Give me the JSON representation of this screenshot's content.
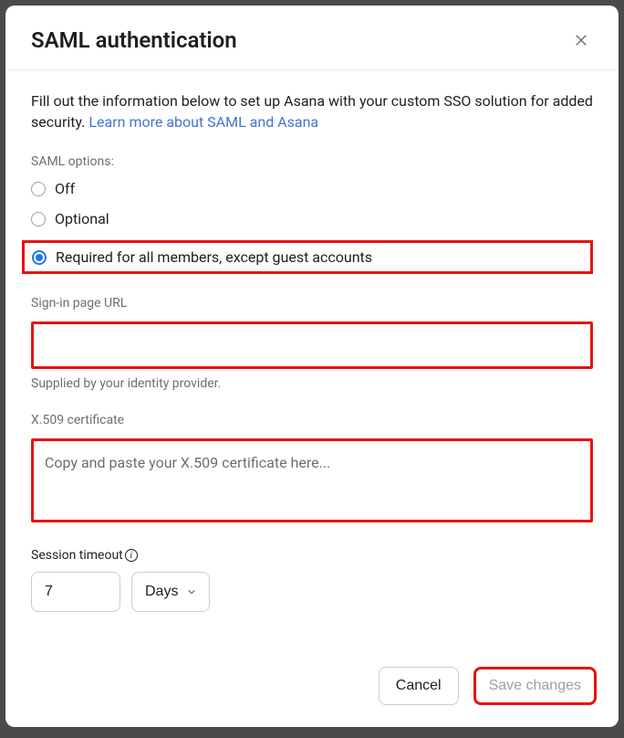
{
  "modal": {
    "title": "SAML authentication",
    "intro_text": "Fill out the information below to set up Asana with your custom SSO solution for added security. ",
    "intro_link": "Learn more about SAML and Asana",
    "saml_options_label": "SAML options:",
    "options": {
      "off": "Off",
      "optional": "Optional",
      "required": "Required for all members, except guest accounts"
    },
    "selected_option": "required",
    "signin_url": {
      "label": "Sign-in page URL",
      "value": "",
      "helper": "Supplied by your identity provider."
    },
    "x509": {
      "label": "X.509 certificate",
      "placeholder": "Copy and paste your X.509 certificate here...",
      "value": ""
    },
    "timeout": {
      "label": "Session timeout",
      "value": "7",
      "unit": "Days"
    },
    "footer": {
      "cancel": "Cancel",
      "save": "Save changes"
    }
  }
}
